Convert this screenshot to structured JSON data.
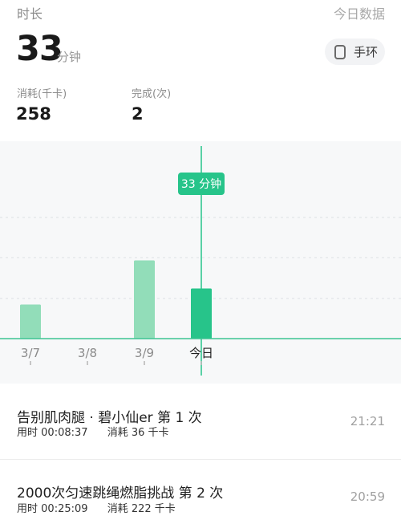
{
  "header": {
    "title": "时长",
    "today_link": "今日数据",
    "duration_value": "33",
    "duration_unit": "分钟",
    "device_label": "手环"
  },
  "stats": [
    {
      "label": "消耗(千卡)",
      "value": "258"
    },
    {
      "label": "完成(次)",
      "value": "2"
    }
  ],
  "chart_data": {
    "type": "bar",
    "categories": [
      "3/7",
      "3/8",
      "3/9",
      "今日"
    ],
    "values": [
      8.5,
      0,
      19.5,
      12.5
    ],
    "selected_index": 3,
    "tooltip": "33 分钟",
    "colors": {
      "bar": "#92ddb9",
      "selected": "#27c48a",
      "axis": "#3dc493"
    },
    "grid": true
  },
  "records": [
    {
      "title": "告别肌肉腿 · 碧小仙er 第 1 次",
      "duration_label": "用时",
      "duration": "00:08:37",
      "calories_label": "消耗",
      "calories": "36 千卡",
      "time": "21:21"
    },
    {
      "title": "2000次匀速跳绳燃脂挑战 第 2 次",
      "duration_label": "用时",
      "duration": "00:25:09",
      "calories_label": "消耗",
      "calories": "222 千卡",
      "time": "20:59"
    }
  ]
}
